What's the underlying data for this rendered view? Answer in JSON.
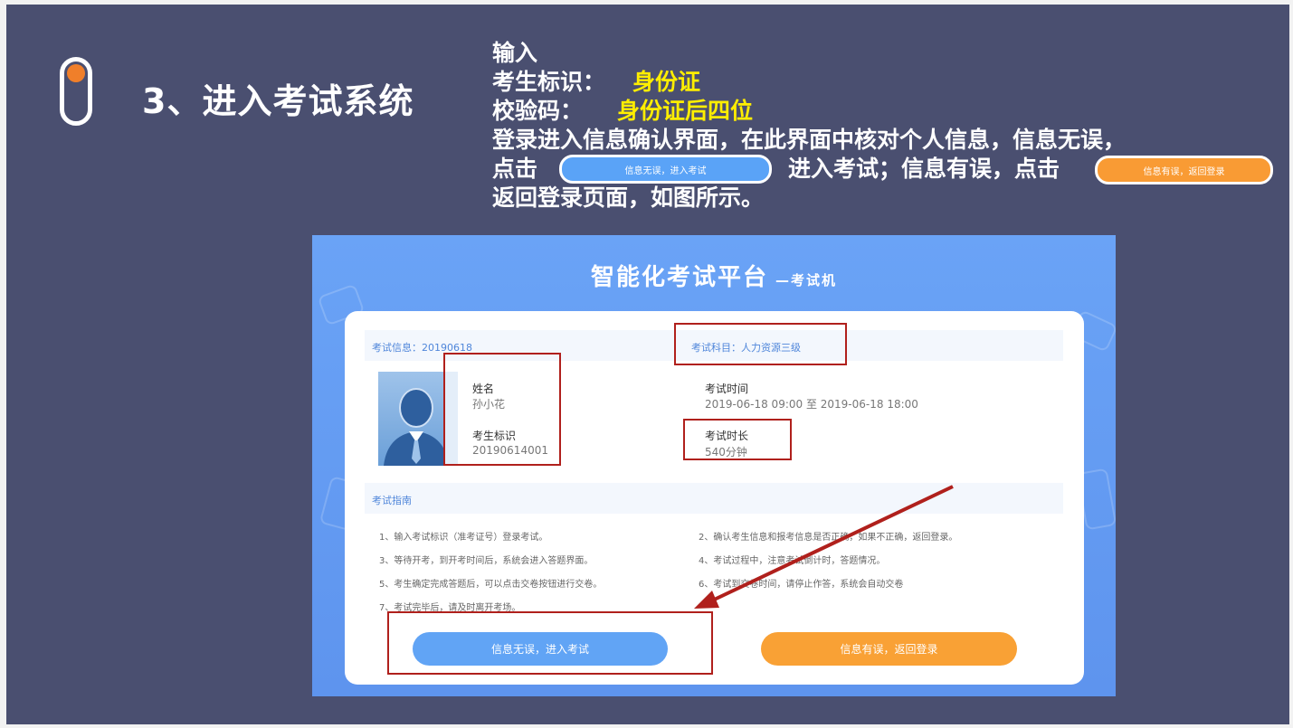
{
  "slide": {
    "title": "3、进入考试系统",
    "instructions": {
      "line1": "输入",
      "line2_label": "考生标识：",
      "line2_value": "身份证",
      "line3_label": "校验码：",
      "line3_value": "身份证后四位",
      "line4": "登录进入信息确认界面，在此界面中核对个人信息，信息无误，",
      "line5_a": "点击",
      "line5_b": "进入考试；信息有误，点击",
      "line6": "返回登录页面，如图所示。"
    },
    "inline_buttons": {
      "confirm": "信息无误，进入考试",
      "back": "信息有误，返回登录"
    }
  },
  "exam_screen": {
    "title": "智能化考试平台",
    "subtitle": "—考试机",
    "exam_info": "考试信息：20190618",
    "exam_subject": "考试科目：人力资源三级",
    "name_label": "姓名",
    "name_value": "孙小花",
    "id_label": "考生标识",
    "id_value": "20190614001",
    "time_label": "考试时间",
    "time_value": "2019-06-18 09:00 至 2019-06-18 18:00",
    "duration_label": "考试时长",
    "duration_value": "540分钟",
    "guide_title": "考试指南",
    "guide": [
      "1、输入考试标识（准考证号）登录考试。",
      "2、确认考生信息和报考信息是否正确，如果不正确，返回登录。",
      "3、等待开考，到开考时间后，系统会进入答题界面。",
      "4、考试过程中，注意考试倒计时，答题情况。",
      "5、考生确定完成答题后，可以点击交卷按钮进行交卷。",
      "6、考试到交卷时间，请停止作答，系统会自动交卷",
      "7、考试完毕后，请及时离开考场。"
    ],
    "confirm_button": "信息无误，进入考试",
    "back_button": "信息有误，返回登录"
  },
  "colors": {
    "slide_bg": "#4a4f70",
    "accent_orange": "#f07f2a",
    "highlight_yellow": "#ffee00",
    "button_blue": "#61a4f5",
    "button_orange": "#f9a135",
    "annotation_red": "#b0201c"
  }
}
